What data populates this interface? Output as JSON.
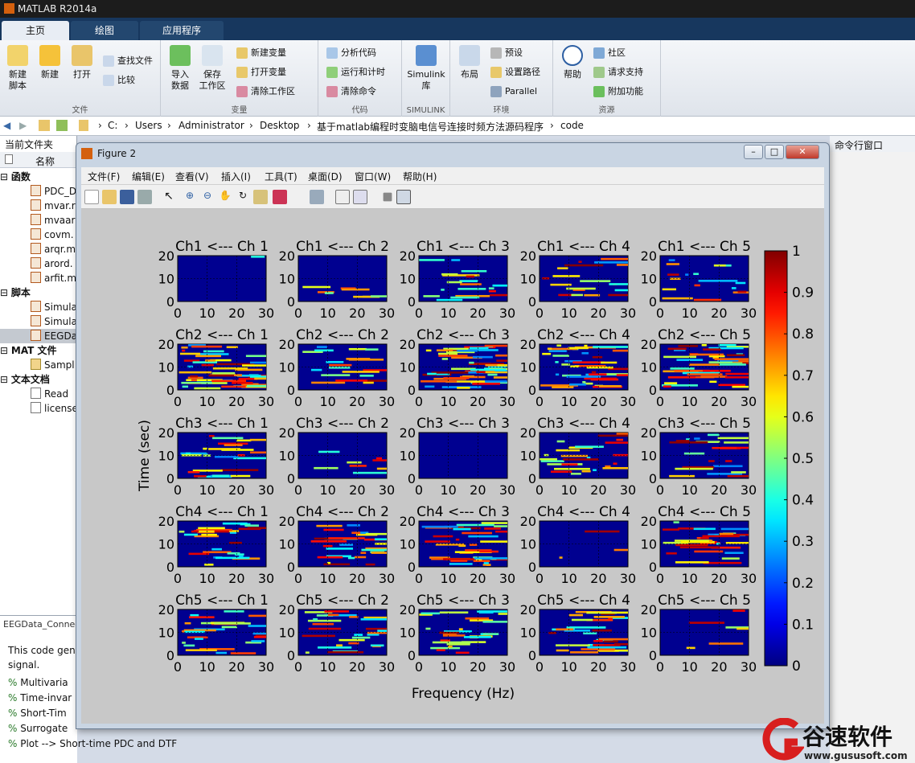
{
  "app": {
    "title": "MATLAB R2014a"
  },
  "tabs": [
    "主页",
    "绘图",
    "应用程序"
  ],
  "ribbon": {
    "file": {
      "new_script": "新建\n脚本",
      "new": "新建",
      "open": "打开",
      "find_files": "查找文件",
      "compare": "比较",
      "label": "文件"
    },
    "variable": {
      "import": "导入\n数据",
      "save_ws": "保存\n工作区",
      "new_var": "新建变量",
      "open_var": "打开变量",
      "clear_ws": "清除工作区",
      "label": "变量"
    },
    "code": {
      "analyze": "分析代码",
      "run_time": "运行和计时",
      "clear_cmd": "清除命令",
      "label": "代码"
    },
    "simulink": {
      "lib": "Simulink\n库",
      "label": "SIMULINK"
    },
    "env": {
      "layout": "布局",
      "prefs": "预设",
      "set_path": "设置路径",
      "parallel": "Parallel",
      "label": "环境"
    },
    "resources": {
      "help": "帮助",
      "community": "社区",
      "support": "请求支持",
      "addons": "附加功能",
      "label": "资源"
    }
  },
  "address": {
    "crumbs": [
      "C:",
      "Users",
      "Administrator",
      "Desktop",
      "基于matlab编程时变脑电信号连接时频方法源码程序",
      "code"
    ]
  },
  "left": {
    "header": "当前文件夹",
    "col": "名称",
    "groups": [
      {
        "title": "函数",
        "items": [
          "PDC_D",
          "mvar.r",
          "mvaar",
          "covm.",
          "arqr.m",
          "arord.",
          "arfit.m"
        ]
      },
      {
        "title": "脚本",
        "items": [
          "Simula",
          "Simula",
          "EEGDa"
        ]
      },
      {
        "title": "MAT 文件",
        "items": [
          "Sampl"
        ]
      },
      {
        "title": "文本文档",
        "items": [
          "Read",
          "license"
        ]
      }
    ]
  },
  "bottom": {
    "file": "EEGData_Connec",
    "desc": "This code gen signal.",
    "items": [
      "Multivaria",
      "Time-invar",
      "Short-Tim",
      "Surrogate",
      "Plot --> Short-time PDC and DTF"
    ]
  },
  "right": {
    "header": "命令行窗口"
  },
  "figure": {
    "title": "Figure 2",
    "menu": [
      "文件(F)",
      "编辑(E)",
      "查看(V)",
      "插入(I)",
      "工具(T)",
      "桌面(D)",
      "窗口(W)",
      "帮助(H)"
    ]
  },
  "chart_data": {
    "type": "heatmap",
    "grid_rows": 5,
    "grid_cols": 5,
    "panel_titles": [
      [
        "Ch1 <--- Ch 1",
        "Ch1 <--- Ch 2",
        "Ch1 <--- Ch 3",
        "Ch1 <--- Ch 4",
        "Ch1 <--- Ch 5"
      ],
      [
        "Ch2 <--- Ch 1",
        "Ch2 <--- Ch 2",
        "Ch2 <--- Ch 3",
        "Ch2 <--- Ch 4",
        "Ch2 <--- Ch 5"
      ],
      [
        "Ch3 <--- Ch 1",
        "Ch3 <--- Ch 2",
        "Ch3 <--- Ch 3",
        "Ch3 <--- Ch 4",
        "Ch3 <--- Ch 5"
      ],
      [
        "Ch4 <--- Ch 1",
        "Ch4 <--- Ch 2",
        "Ch4 <--- Ch 3",
        "Ch4 <--- Ch 4",
        "Ch4 <--- Ch 5"
      ],
      [
        "Ch5 <--- Ch 1",
        "Ch5 <--- Ch 2",
        "Ch5 <--- Ch 3",
        "Ch5 <--- Ch 4",
        "Ch5 <--- Ch 5"
      ]
    ],
    "xlabel": "Frequency (Hz)",
    "ylabel": "Time (sec)",
    "xticks": [
      "0",
      "10",
      "20",
      "30"
    ],
    "yticks": [
      "0",
      "10",
      "20"
    ],
    "xlim": [
      0,
      30
    ],
    "ylim": [
      0,
      20
    ],
    "colorbar": {
      "ticks": [
        "0",
        "0.1",
        "0.2",
        "0.3",
        "0.4",
        "0.5",
        "0.6",
        "0.7",
        "0.8",
        "0.9",
        "1"
      ],
      "range": [
        0,
        1
      ]
    },
    "density": [
      [
        0.02,
        0.15,
        0.35,
        0.35,
        0.3
      ],
      [
        0.9,
        0.35,
        0.95,
        0.8,
        0.75
      ],
      [
        0.45,
        0.15,
        0.0,
        0.45,
        0.4
      ],
      [
        0.5,
        0.55,
        0.7,
        0.05,
        0.55
      ],
      [
        0.5,
        0.5,
        0.5,
        0.6,
        0.1
      ]
    ]
  },
  "watermark": {
    "brand": "谷速软件",
    "url": "www.gususoft.com"
  }
}
